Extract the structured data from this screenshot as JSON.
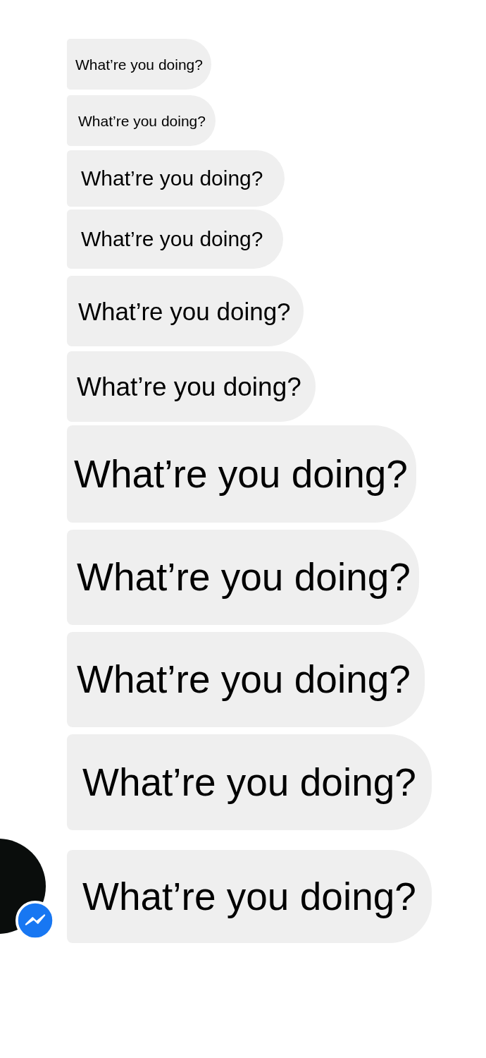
{
  "messages": [
    {
      "text": "What’re you doing?"
    },
    {
      "text": "What’re you doing?"
    },
    {
      "text": "What’re you doing?"
    },
    {
      "text": "What’re you doing?"
    },
    {
      "text": "What’re you doing?"
    },
    {
      "text": "What’re you doing?"
    },
    {
      "text": "What’re you doing?"
    },
    {
      "text": "What’re you doing?"
    },
    {
      "text": "What’re you doing?"
    },
    {
      "text": "What’re you doing?"
    },
    {
      "text": "What’re you doing?"
    }
  ]
}
